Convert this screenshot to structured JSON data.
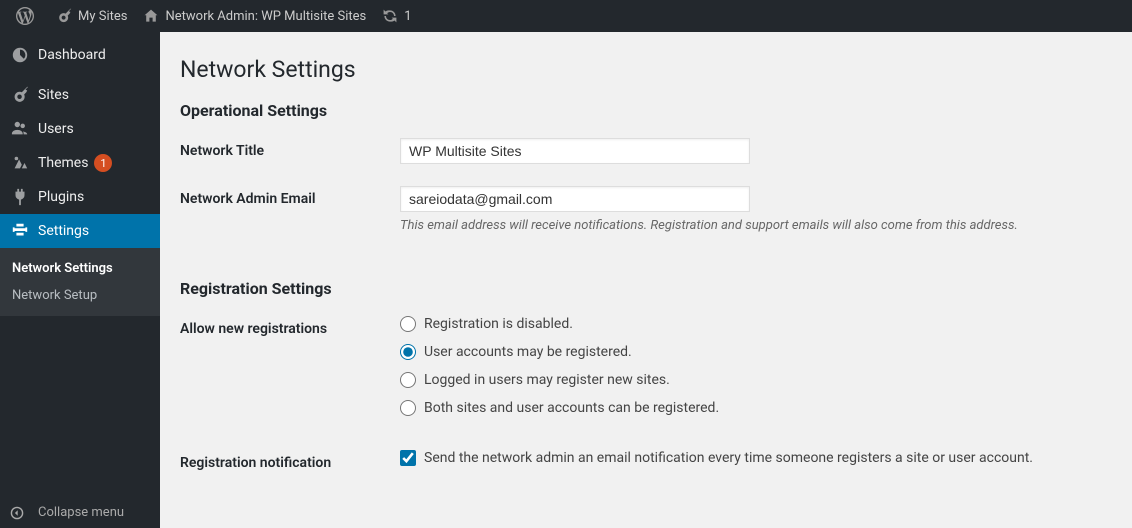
{
  "adminbar": {
    "my_sites": "My Sites",
    "site_name": "Network Admin: WP Multisite Sites",
    "updates": "1"
  },
  "sidebar": {
    "dashboard": "Dashboard",
    "sites": "Sites",
    "users": "Users",
    "themes": "Themes",
    "themes_badge": "1",
    "plugins": "Plugins",
    "settings": "Settings",
    "submenu": {
      "network_settings": "Network Settings",
      "network_setup": "Network Setup"
    },
    "collapse": "Collapse menu"
  },
  "page": {
    "title": "Network Settings",
    "operational": {
      "heading": "Operational Settings",
      "network_title_label": "Network Title",
      "network_title_value": "WP Multisite Sites",
      "admin_email_label": "Network Admin Email",
      "admin_email_value": "sareiodata@gmail.com",
      "admin_email_desc": "This email address will receive notifications. Registration and support emails will also come from this address."
    },
    "registration": {
      "heading": "Registration Settings",
      "allow_label": "Allow new registrations",
      "opt_disabled": "Registration is disabled.",
      "opt_users": "User accounts may be registered.",
      "opt_logged": "Logged in users may register new sites.",
      "opt_both": "Both sites and user accounts can be registered.",
      "notification_label": "Registration notification",
      "notification_text": "Send the network admin an email notification every time someone registers a site or user account."
    }
  }
}
